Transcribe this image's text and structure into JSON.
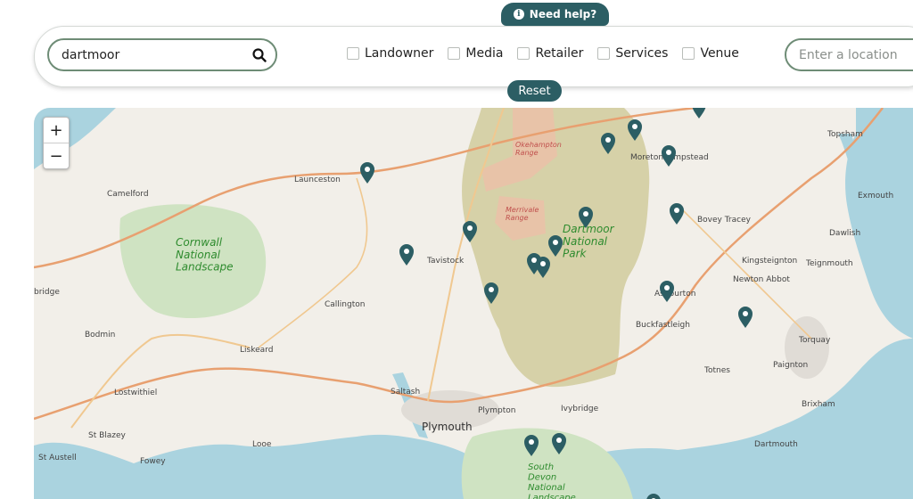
{
  "help": {
    "label": "Need help?",
    "icon": "info-icon"
  },
  "search": {
    "value": "dartmoor",
    "icon": "search-icon"
  },
  "filters": [
    {
      "label": "Landowner",
      "checked": false
    },
    {
      "label": "Media",
      "checked": false
    },
    {
      "label": "Retailer",
      "checked": false
    },
    {
      "label": "Services",
      "checked": false
    },
    {
      "label": "Venue",
      "checked": false
    }
  ],
  "location": {
    "placeholder": "Enter a location"
  },
  "reset": {
    "label": "Reset"
  },
  "zoom": {
    "in": "+",
    "out": "−"
  },
  "map": {
    "towns": [
      "Topsham",
      "Launceston",
      "Camelford",
      "Moretonhampstead",
      "Exmouth",
      "Bovey Tracey",
      "Dawlish",
      "Tavistock",
      "Kingsteignton",
      "Teignmouth",
      "Newton Abbot",
      "Callington",
      "Ashburton",
      "Buckfastleigh",
      "Bodmin",
      "Liskeard",
      "Torquay",
      "Lostwithiel",
      "Totnes",
      "Paignton",
      "Saltash",
      "Plympton",
      "Ivybridge",
      "Brixham",
      "Plymouth",
      "St Blazey",
      "Looe",
      "Dartmouth",
      "St Austell",
      "Fowey",
      "bridge"
    ],
    "areas": [
      "Okehampton Range",
      "Merrivale Range",
      "Dartmoor National Park",
      "Cornwall National Landscape",
      "South Devon National Landscape"
    ],
    "pin_color": "#2c5e64"
  }
}
